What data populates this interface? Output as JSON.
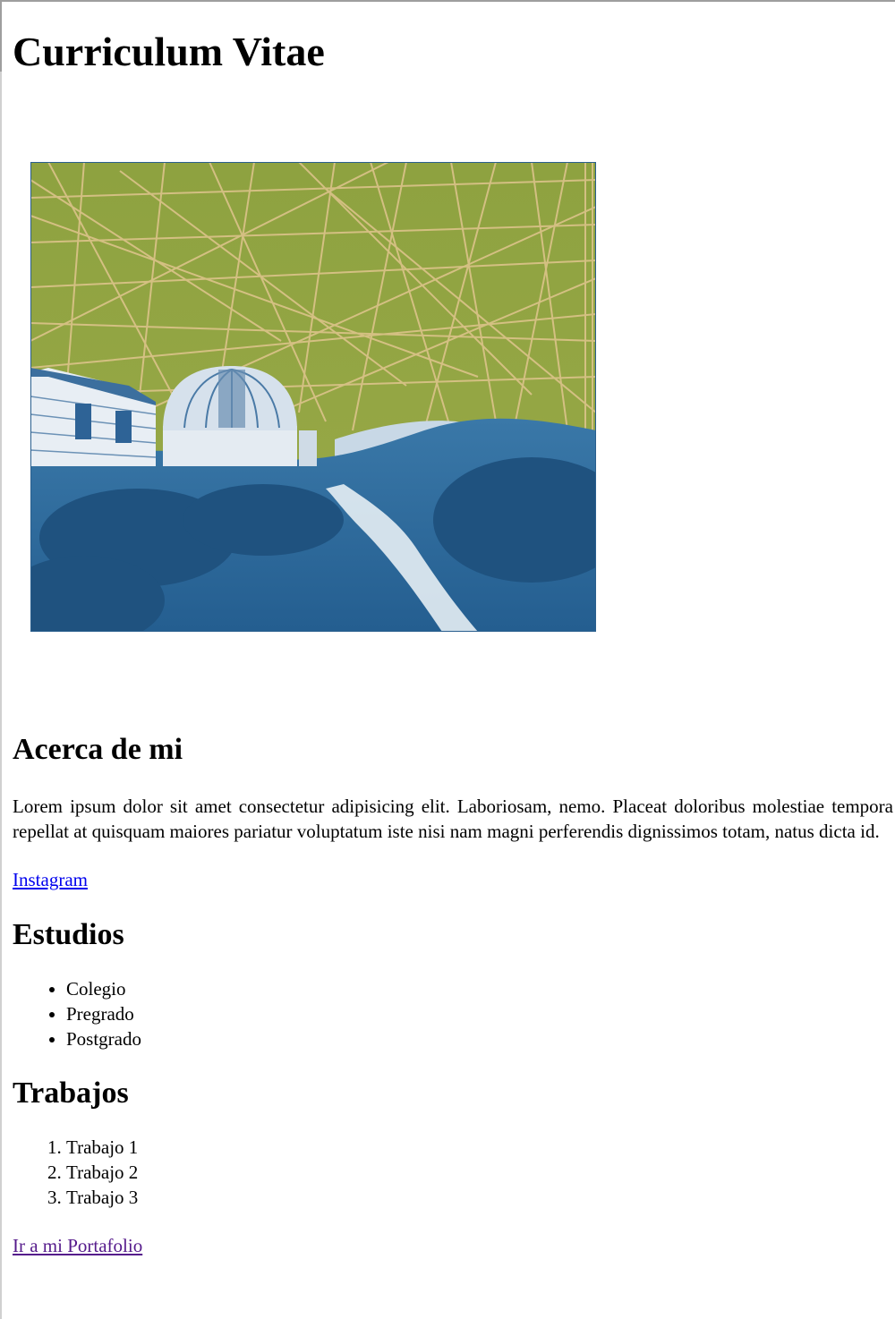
{
  "title": "Curriculum Vitae",
  "hero": {
    "icon": "observatory-photo"
  },
  "about": {
    "heading": "Acerca de mi",
    "text": "Lorem ipsum dolor sit amet consectetur adipisicing elit. Laboriosam, nemo. Placeat doloribus molestiae tempora repellat at quisquam maiores pariatur voluptatum iste nisi nam magni perferendis dignissimos totam, natus dicta id.",
    "link": "Instagram"
  },
  "studies": {
    "heading": "Estudios",
    "items": [
      "Colegio",
      "Pregrado",
      "Postgrado"
    ]
  },
  "jobs": {
    "heading": "Trabajos",
    "items": [
      "Trabajo 1",
      "Trabajo 2",
      "Trabajo 3"
    ]
  },
  "portfolio_link": "Ir a mi Portafolio",
  "colors": {
    "link": "#0000ee",
    "visited_link": "#551a8b",
    "sky_green": "#8a9e3c",
    "cyan_blue": "#2f6a9c"
  }
}
